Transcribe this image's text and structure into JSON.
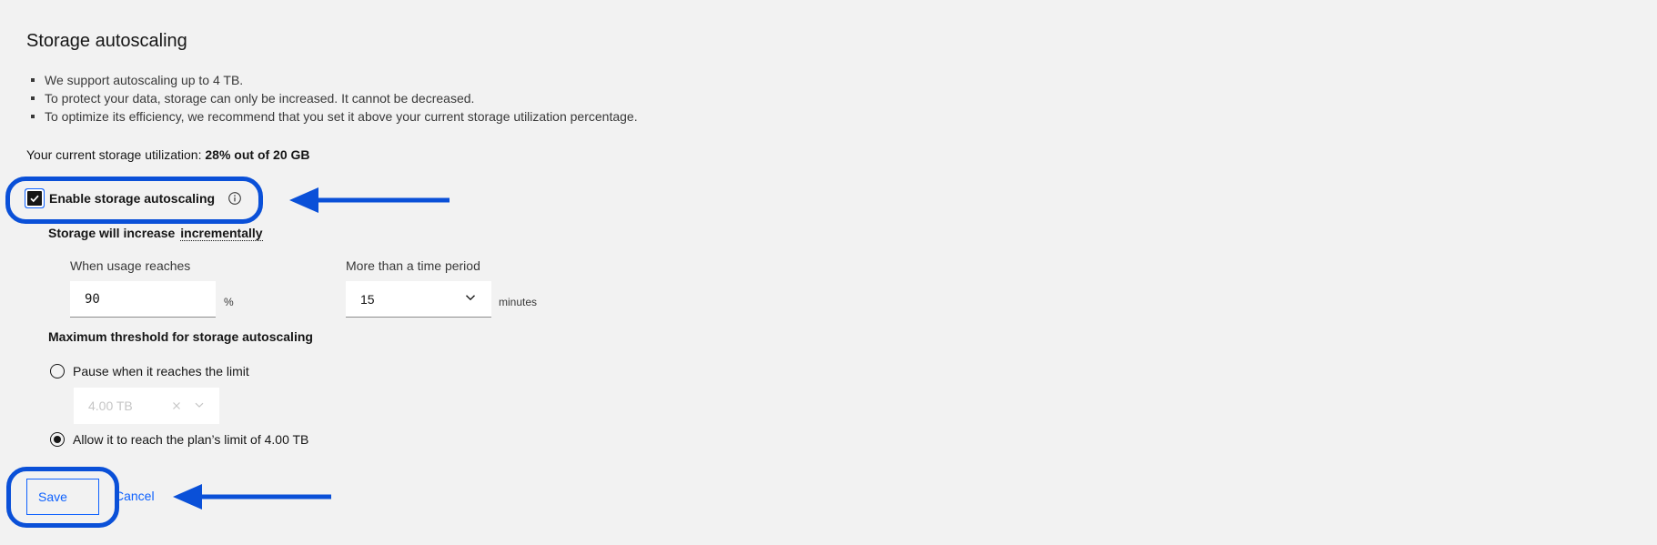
{
  "title": "Storage autoscaling",
  "bullets": [
    "We support autoscaling up to 4 TB.",
    "To protect your data, storage can only be increased. It cannot be decreased.",
    "To optimize its efficiency, we recommend that you set it above your current storage utilization percentage."
  ],
  "utilization": {
    "label": "Your current storage utilization: ",
    "value": "28% out of 20 GB"
  },
  "autoscaling_checkbox": {
    "label": "Enable storage autoscaling",
    "checked": true,
    "icon": "info-icon"
  },
  "increase": {
    "label": "Storage will increase",
    "mode": "incrementally"
  },
  "usage_field": {
    "label": "When usage reaches",
    "value": "90",
    "unit": "%"
  },
  "period_field": {
    "label": "More than a time period",
    "value": "15",
    "unit": "minutes"
  },
  "threshold": {
    "heading": "Maximum threshold for storage autoscaling",
    "pause_option": "Pause when it reaches the limit",
    "pause_limit": "4.00 TB",
    "allow_option": "Allow it to reach the plan’s limit of 4.00 TB",
    "selected": "allow"
  },
  "actions": {
    "save": "Save",
    "cancel": "Cancel"
  },
  "colors": {
    "accent": "#0f62fe",
    "annotation": "#0a50d8",
    "background": "#f2f2f2"
  }
}
